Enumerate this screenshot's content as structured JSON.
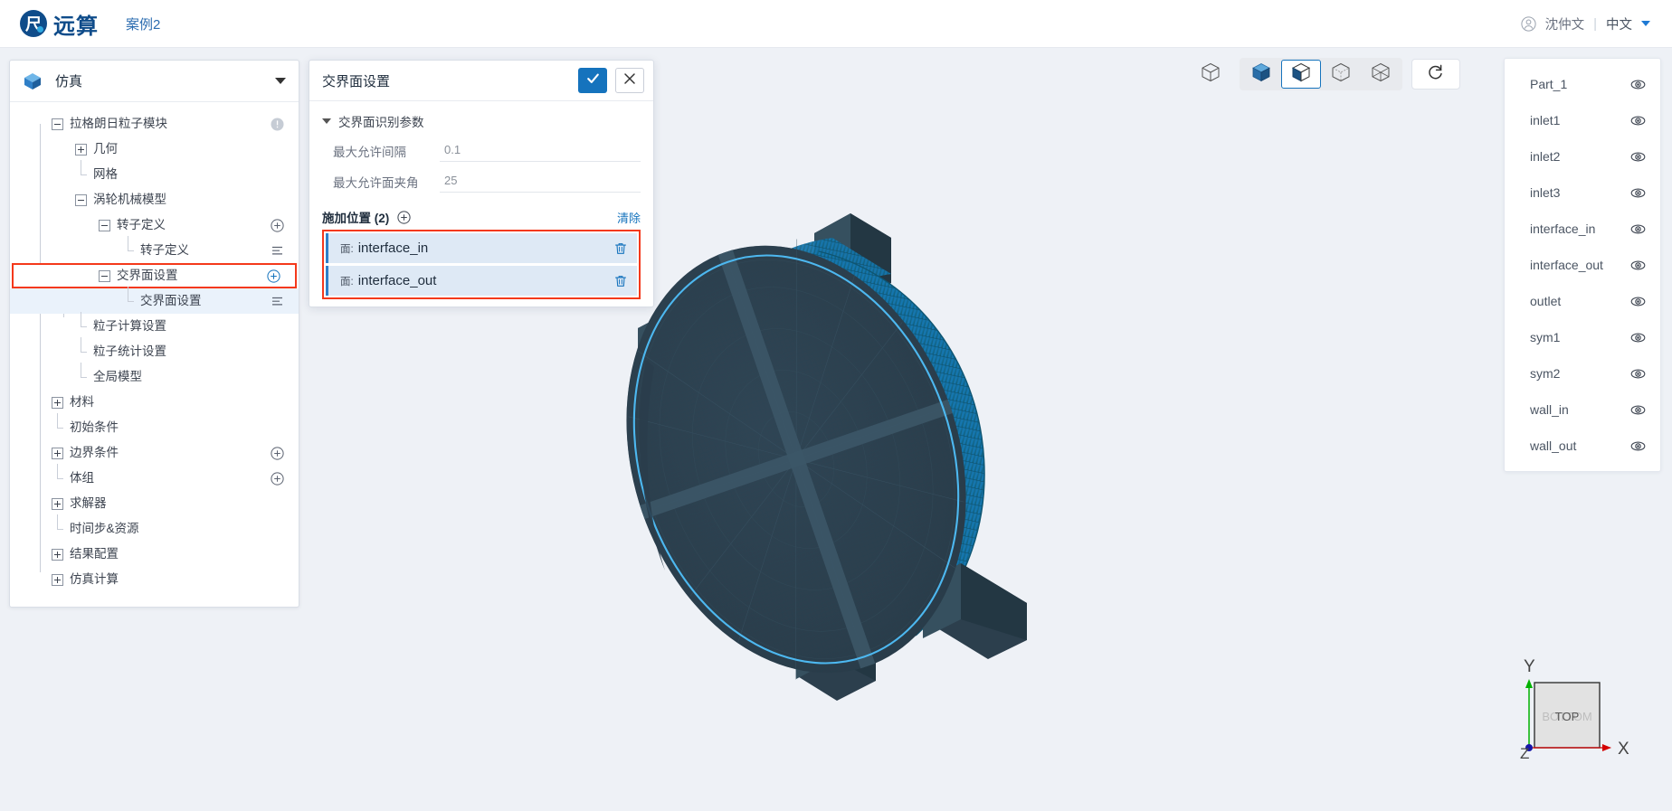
{
  "header": {
    "logo_text": "远算",
    "logo_icon": "company-logo-icon",
    "case_name": "案例2",
    "user_icon": "user-avatar-icon",
    "user_name": "沈仲文",
    "separator": "|",
    "language": "中文",
    "caret_icon": "chevron-down-icon"
  },
  "tree_panel": {
    "header": {
      "icon": "cube-icon",
      "title": "仿真",
      "collapse_icon": "chevron-down-icon"
    },
    "nodes": [
      {
        "label": "拉格朗日粒子模块",
        "toggle": "minus",
        "indent": 0,
        "badge": "warning-icon"
      },
      {
        "label": "几何",
        "toggle": "plus",
        "indent": 1
      },
      {
        "label": "网格",
        "toggle": "leaf",
        "indent": 1
      },
      {
        "label": "涡轮机械模型",
        "toggle": "minus",
        "indent": 1
      },
      {
        "label": "转子定义",
        "toggle": "minus",
        "indent": 2,
        "badge": "add-icon"
      },
      {
        "label": "转子定义",
        "toggle": "leaf",
        "indent": 3,
        "badge": "list-icon"
      },
      {
        "label": "交界面设置",
        "toggle": "minus",
        "indent": 2,
        "badge": "add-icon",
        "highlight": "red-box"
      },
      {
        "label": "交界面设置",
        "toggle": "leaf",
        "indent": 3,
        "badge": "list-icon",
        "state": "selected"
      },
      {
        "label": "粒子计算设置",
        "toggle": "leaf",
        "indent": 1
      },
      {
        "label": "粒子统计设置",
        "toggle": "leaf",
        "indent": 1
      },
      {
        "label": "全局模型",
        "toggle": "leaf",
        "indent": 1
      },
      {
        "label": "材料",
        "toggle": "plus",
        "indent": 1
      },
      {
        "label": "初始条件",
        "toggle": "leaf",
        "indent": 1
      },
      {
        "label": "边界条件",
        "toggle": "plus",
        "indent": 1,
        "badge": "add-icon"
      },
      {
        "label": "体组",
        "toggle": "leaf",
        "indent": 1,
        "badge": "add-icon"
      },
      {
        "label": "求解器",
        "toggle": "plus",
        "indent": 1
      },
      {
        "label": "时间步&资源",
        "toggle": "leaf",
        "indent": 1
      },
      {
        "label": "结果配置",
        "toggle": "plus",
        "indent": 1
      },
      {
        "label": "仿真计算",
        "toggle": "plus",
        "indent": 1
      }
    ]
  },
  "dialog": {
    "title": "交界面设置",
    "confirm_icon": "check-icon",
    "cancel_icon": "close-icon",
    "section": {
      "expand_icon": "chevron-down-icon",
      "title": "交界面识别参数",
      "fields": [
        {
          "label": "最大允许间隔",
          "value": "0.1"
        },
        {
          "label": "最大允许面夹角",
          "value": "25"
        }
      ]
    },
    "apply_section": {
      "title": "施加位置 (2)",
      "add_icon": "plus-circle-icon",
      "clear_label": "清除",
      "items": [
        {
          "prefix": "面:",
          "name": "interface_in",
          "delete_icon": "trash-icon"
        },
        {
          "prefix": "面:",
          "name": "interface_out",
          "delete_icon": "trash-icon"
        }
      ]
    }
  },
  "viewport_toolbar": {
    "buttons": [
      {
        "name": "wireframe-view-icon",
        "active": false,
        "grouped": false
      },
      {
        "name": "shaded-solid-view-icon",
        "active": false,
        "grouped": true
      },
      {
        "name": "shaded-with-edges-view-icon",
        "active": true,
        "grouped": true
      },
      {
        "name": "hidden-line-view-icon",
        "active": false,
        "grouped": true
      },
      {
        "name": "wireframe-edges-view-icon",
        "active": false,
        "grouped": true
      },
      {
        "name": "reset-view-icon",
        "active": false,
        "grouped": false
      }
    ]
  },
  "parts_panel": {
    "items": [
      {
        "label": "Part_1",
        "visibility_icon": "eye-icon"
      },
      {
        "label": "inlet1",
        "visibility_icon": "eye-icon"
      },
      {
        "label": "inlet2",
        "visibility_icon": "eye-icon"
      },
      {
        "label": "inlet3",
        "visibility_icon": "eye-icon"
      },
      {
        "label": "interface_in",
        "visibility_icon": "eye-icon"
      },
      {
        "label": "interface_out",
        "visibility_icon": "eye-icon"
      },
      {
        "label": "outlet",
        "visibility_icon": "eye-icon"
      },
      {
        "label": "sym1",
        "visibility_icon": "eye-icon"
      },
      {
        "label": "sym2",
        "visibility_icon": "eye-icon"
      },
      {
        "label": "wall_in",
        "visibility_icon": "eye-icon"
      },
      {
        "label": "wall_out",
        "visibility_icon": "eye-icon"
      }
    ]
  },
  "axis_triad": {
    "x_label": "X",
    "y_label": "Y",
    "z_label": "Z",
    "face_label": "TOP",
    "face_label_back": "BOTTOM",
    "x_color": "#d40000",
    "y_color": "#00b200",
    "z_color": "#1515a8"
  },
  "colors": {
    "accent": "#1573bd",
    "highlight_box": "#f4391b",
    "model_body": "#2c3f4d",
    "model_blade": "#1374ab",
    "selection_edge": "#4db8f0",
    "canvas_bg": "#eef1f6"
  }
}
